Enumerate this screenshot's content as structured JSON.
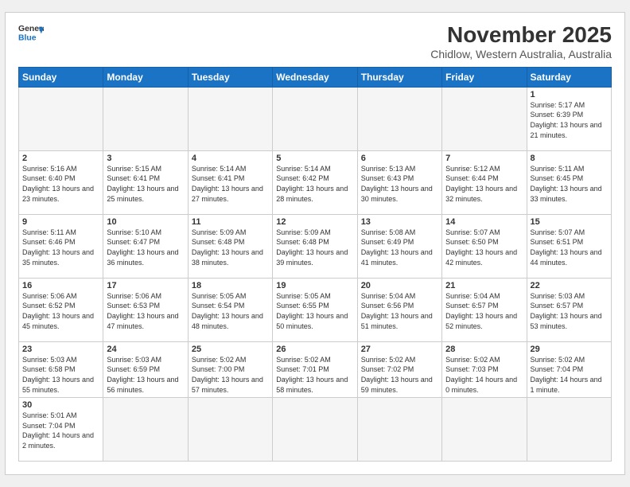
{
  "header": {
    "logo_general": "General",
    "logo_blue": "Blue",
    "month_title": "November 2025",
    "subtitle": "Chidlow, Western Australia, Australia"
  },
  "weekdays": [
    "Sunday",
    "Monday",
    "Tuesday",
    "Wednesday",
    "Thursday",
    "Friday",
    "Saturday"
  ],
  "days": [
    {
      "num": "",
      "empty": true
    },
    {
      "num": "",
      "empty": true
    },
    {
      "num": "",
      "empty": true
    },
    {
      "num": "",
      "empty": true
    },
    {
      "num": "",
      "empty": true
    },
    {
      "num": "",
      "empty": true
    },
    {
      "num": "1",
      "rise": "5:17 AM",
      "set": "6:39 PM",
      "daylight": "13 hours and 21 minutes."
    },
    {
      "num": "2",
      "rise": "5:16 AM",
      "set": "6:40 PM",
      "daylight": "13 hours and 23 minutes."
    },
    {
      "num": "3",
      "rise": "5:15 AM",
      "set": "6:41 PM",
      "daylight": "13 hours and 25 minutes."
    },
    {
      "num": "4",
      "rise": "5:14 AM",
      "set": "6:41 PM",
      "daylight": "13 hours and 27 minutes."
    },
    {
      "num": "5",
      "rise": "5:14 AM",
      "set": "6:42 PM",
      "daylight": "13 hours and 28 minutes."
    },
    {
      "num": "6",
      "rise": "5:13 AM",
      "set": "6:43 PM",
      "daylight": "13 hours and 30 minutes."
    },
    {
      "num": "7",
      "rise": "5:12 AM",
      "set": "6:44 PM",
      "daylight": "13 hours and 32 minutes."
    },
    {
      "num": "8",
      "rise": "5:11 AM",
      "set": "6:45 PM",
      "daylight": "13 hours and 33 minutes."
    },
    {
      "num": "9",
      "rise": "5:11 AM",
      "set": "6:46 PM",
      "daylight": "13 hours and 35 minutes."
    },
    {
      "num": "10",
      "rise": "5:10 AM",
      "set": "6:47 PM",
      "daylight": "13 hours and 36 minutes."
    },
    {
      "num": "11",
      "rise": "5:09 AM",
      "set": "6:48 PM",
      "daylight": "13 hours and 38 minutes."
    },
    {
      "num": "12",
      "rise": "5:09 AM",
      "set": "6:48 PM",
      "daylight": "13 hours and 39 minutes."
    },
    {
      "num": "13",
      "rise": "5:08 AM",
      "set": "6:49 PM",
      "daylight": "13 hours and 41 minutes."
    },
    {
      "num": "14",
      "rise": "5:07 AM",
      "set": "6:50 PM",
      "daylight": "13 hours and 42 minutes."
    },
    {
      "num": "15",
      "rise": "5:07 AM",
      "set": "6:51 PM",
      "daylight": "13 hours and 44 minutes."
    },
    {
      "num": "16",
      "rise": "5:06 AM",
      "set": "6:52 PM",
      "daylight": "13 hours and 45 minutes."
    },
    {
      "num": "17",
      "rise": "5:06 AM",
      "set": "6:53 PM",
      "daylight": "13 hours and 47 minutes."
    },
    {
      "num": "18",
      "rise": "5:05 AM",
      "set": "6:54 PM",
      "daylight": "13 hours and 48 minutes."
    },
    {
      "num": "19",
      "rise": "5:05 AM",
      "set": "6:55 PM",
      "daylight": "13 hours and 50 minutes."
    },
    {
      "num": "20",
      "rise": "5:04 AM",
      "set": "6:56 PM",
      "daylight": "13 hours and 51 minutes."
    },
    {
      "num": "21",
      "rise": "5:04 AM",
      "set": "6:57 PM",
      "daylight": "13 hours and 52 minutes."
    },
    {
      "num": "22",
      "rise": "5:03 AM",
      "set": "6:57 PM",
      "daylight": "13 hours and 53 minutes."
    },
    {
      "num": "23",
      "rise": "5:03 AM",
      "set": "6:58 PM",
      "daylight": "13 hours and 55 minutes."
    },
    {
      "num": "24",
      "rise": "5:03 AM",
      "set": "6:59 PM",
      "daylight": "13 hours and 56 minutes."
    },
    {
      "num": "25",
      "rise": "5:02 AM",
      "set": "7:00 PM",
      "daylight": "13 hours and 57 minutes."
    },
    {
      "num": "26",
      "rise": "5:02 AM",
      "set": "7:01 PM",
      "daylight": "13 hours and 58 minutes."
    },
    {
      "num": "27",
      "rise": "5:02 AM",
      "set": "7:02 PM",
      "daylight": "13 hours and 59 minutes."
    },
    {
      "num": "28",
      "rise": "5:02 AM",
      "set": "7:03 PM",
      "daylight": "14 hours and 0 minutes."
    },
    {
      "num": "29",
      "rise": "5:02 AM",
      "set": "7:04 PM",
      "daylight": "14 hours and 1 minute."
    },
    {
      "num": "30",
      "rise": "5:01 AM",
      "set": "7:04 PM",
      "daylight": "14 hours and 2 minutes."
    },
    {
      "num": "",
      "empty": true
    },
    {
      "num": "",
      "empty": true
    },
    {
      "num": "",
      "empty": true
    },
    {
      "num": "",
      "empty": true
    },
    {
      "num": "",
      "empty": true
    },
    {
      "num": "",
      "empty": true
    }
  ]
}
